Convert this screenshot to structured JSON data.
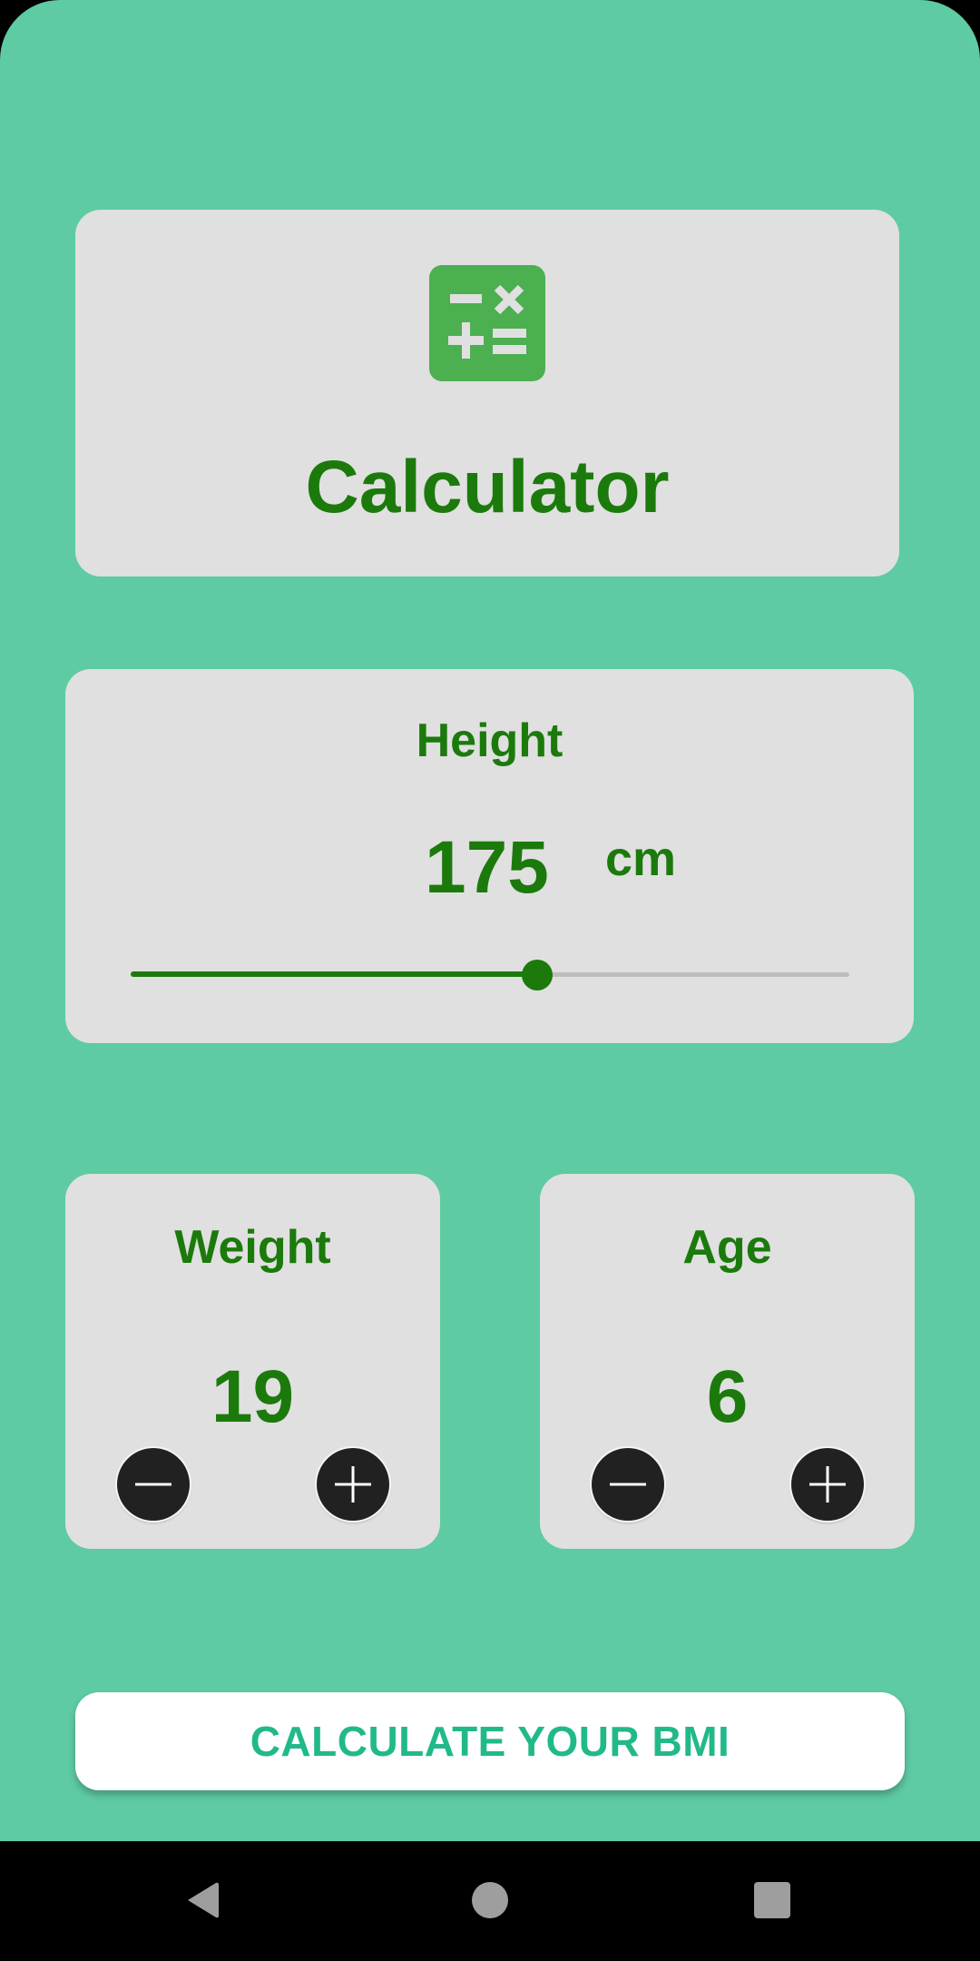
{
  "header": {
    "app_icon": "calculator-icon",
    "title": "Calculator"
  },
  "height": {
    "label": "Height",
    "value": "175",
    "unit": "cm",
    "slider_fraction": 0.566
  },
  "weight": {
    "label": "Weight",
    "value": "19",
    "decrement_icon": "minus-icon",
    "increment_icon": "plus-icon"
  },
  "age": {
    "label": "Age",
    "value": "6",
    "decrement_icon": "minus-icon",
    "increment_icon": "plus-icon"
  },
  "action": {
    "label": "CALCULATE YOUR BMI"
  },
  "nav": {
    "back_icon": "back-triangle-icon",
    "home_icon": "home-circle-icon",
    "recents_icon": "recents-square-icon"
  },
  "colors": {
    "background": "#5ecba3",
    "card": "#e0e0e0",
    "accent_text": "#1b7a0b",
    "icon_green": "#4caf50",
    "button_text": "#22b98a"
  }
}
